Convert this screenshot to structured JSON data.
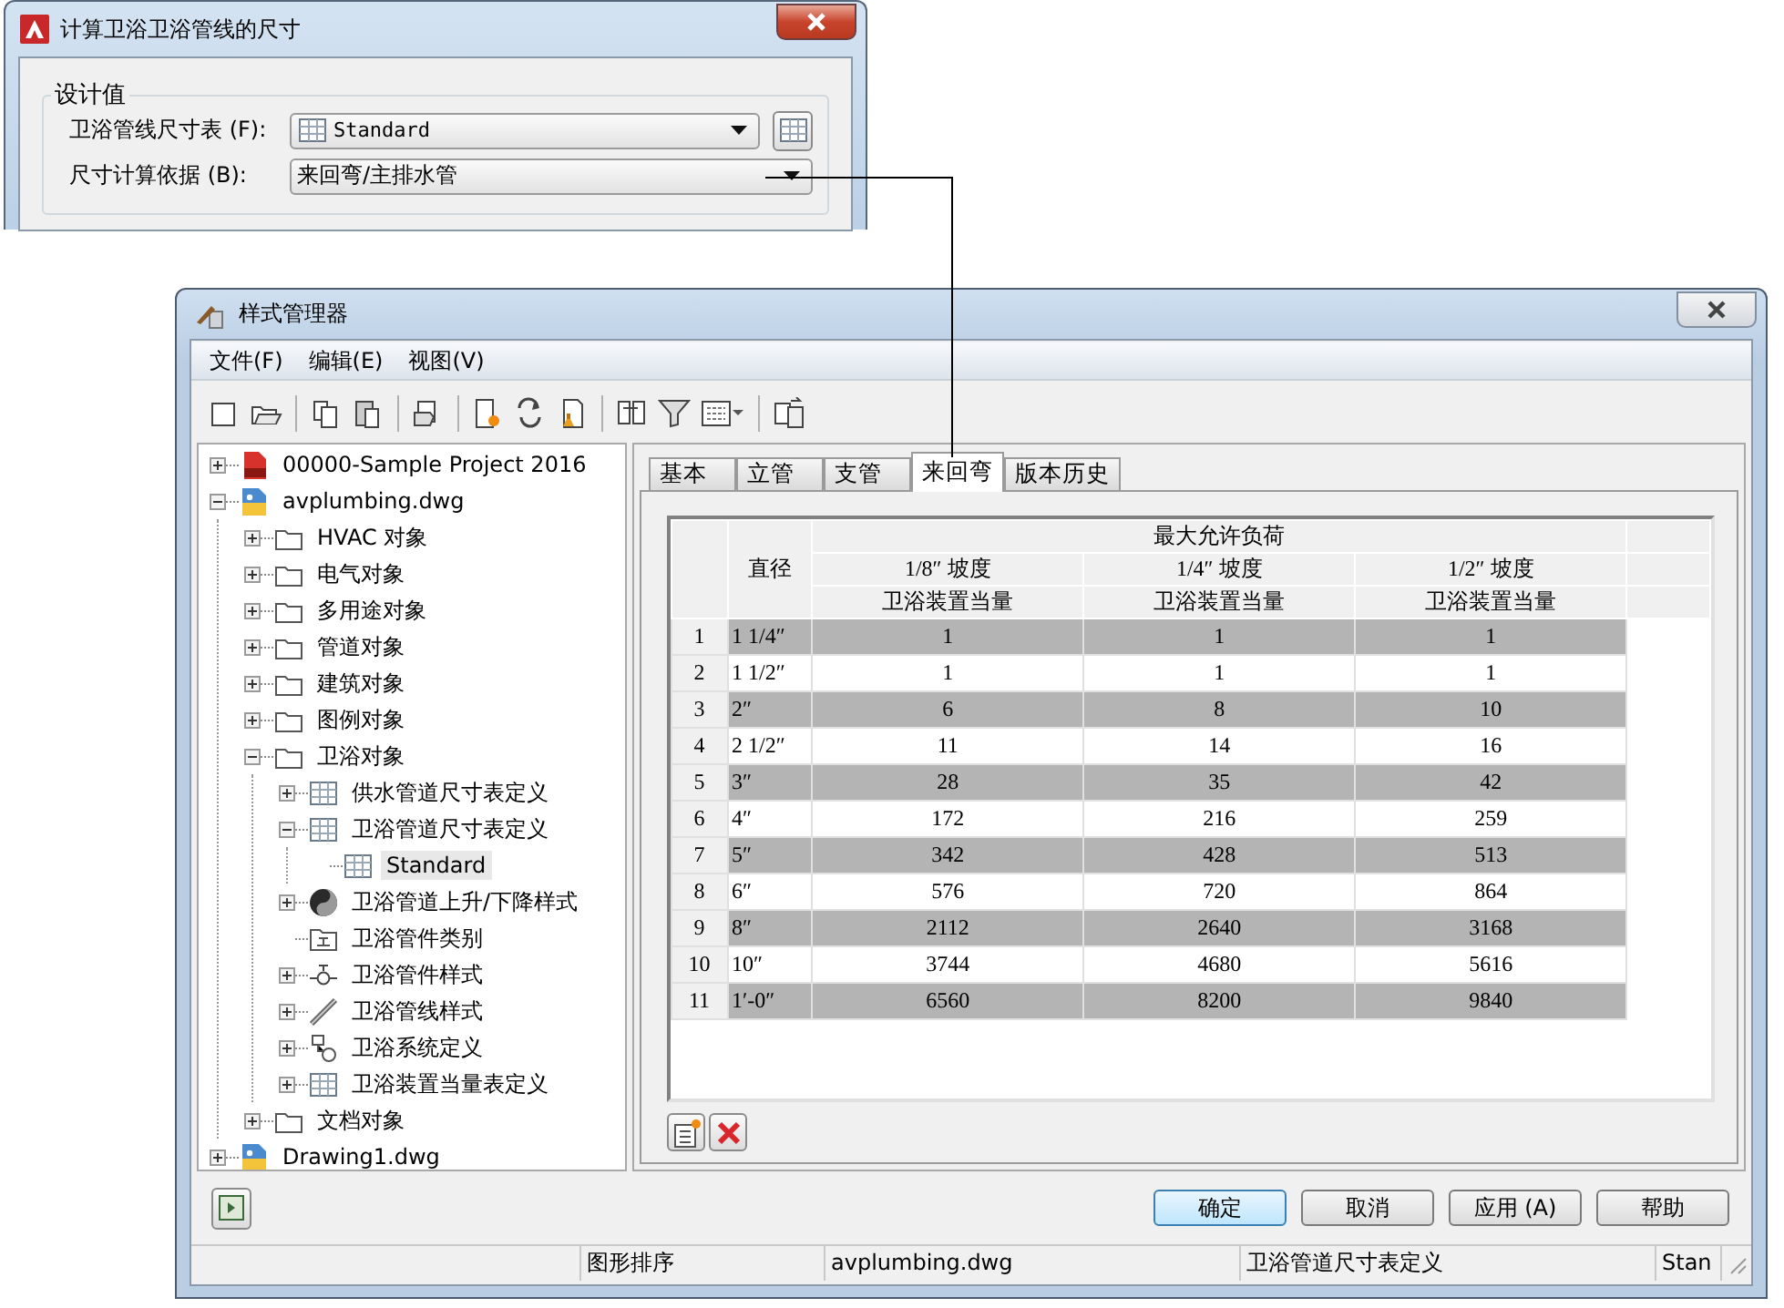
{
  "calc_dialog": {
    "title": "计算卫浴卫浴管线的尺寸",
    "group_label": "设计值",
    "fields": [
      {
        "label": "卫浴管线尺寸表 (F):",
        "value": "Standard",
        "kind": "table"
      },
      {
        "label": "尺寸计算依据 (B):",
        "value": "来回弯/主排水管",
        "kind": "plain"
      }
    ]
  },
  "style_manager": {
    "title": "样式管理器",
    "menu": [
      "文件(F)",
      "编辑(E)",
      "视图(V)"
    ],
    "tree": [
      {
        "label": "00000-Sample Project 2016",
        "kind": "project",
        "expanded": false,
        "selected": false
      },
      {
        "label": "avplumbing.dwg",
        "kind": "drawing",
        "expanded": true,
        "selected": false,
        "children": [
          {
            "label": "HVAC 对象",
            "kind": "folder",
            "expanded": false,
            "selected": false
          },
          {
            "label": "电气对象",
            "kind": "folder",
            "expanded": false,
            "selected": false
          },
          {
            "label": "多用途对象",
            "kind": "folder",
            "expanded": false,
            "selected": false
          },
          {
            "label": "管道对象",
            "kind": "folder",
            "expanded": false,
            "selected": false
          },
          {
            "label": "建筑对象",
            "kind": "folder",
            "expanded": false,
            "selected": false
          },
          {
            "label": "图例对象",
            "kind": "folder",
            "expanded": false,
            "selected": false
          },
          {
            "label": "卫浴对象",
            "kind": "folder",
            "expanded": true,
            "selected": false,
            "children": [
              {
                "label": "供水管道尺寸表定义",
                "kind": "table",
                "expanded": false,
                "selected": false
              },
              {
                "label": "卫浴管道尺寸表定义",
                "kind": "table",
                "expanded": true,
                "selected": false,
                "children": [
                  {
                    "label": "Standard",
                    "kind": "table",
                    "leaf": true,
                    "selected": true
                  }
                ]
              },
              {
                "label": "卫浴管道上升/下降样式",
                "kind": "riser",
                "expanded": false,
                "selected": false
              },
              {
                "label": "卫浴管件类别",
                "kind": "category",
                "leaf": true,
                "selected": false
              },
              {
                "label": "卫浴管件样式",
                "kind": "fitting",
                "expanded": false,
                "selected": false
              },
              {
                "label": "卫浴管线样式",
                "kind": "line",
                "expanded": false,
                "selected": false
              },
              {
                "label": "卫浴系统定义",
                "kind": "system",
                "expanded": false,
                "selected": false
              },
              {
                "label": "卫浴装置当量表定义",
                "kind": "table",
                "expanded": false,
                "selected": false
              }
            ]
          },
          {
            "label": "文档对象",
            "kind": "folder",
            "expanded": false,
            "selected": false
          }
        ]
      },
      {
        "label": "Drawing1.dwg",
        "kind": "drawing",
        "expanded": false,
        "selected": false
      }
    ],
    "tabs": [
      {
        "label": "基本",
        "selected": false
      },
      {
        "label": "立管",
        "selected": false
      },
      {
        "label": "支管",
        "selected": false
      },
      {
        "label": "来回弯",
        "selected": true
      },
      {
        "label": "版本历史",
        "selected": false
      }
    ],
    "table": {
      "diameter_header": "直径",
      "group_header": "最大允许负荷",
      "columns": [
        {
          "slope": "1/8″ 坡度",
          "unit": "卫浴装置当量"
        },
        {
          "slope": "1/4″ 坡度",
          "unit": "卫浴装置当量"
        },
        {
          "slope": "1/2″ 坡度",
          "unit": "卫浴装置当量"
        }
      ],
      "rows": [
        {
          "number": "1",
          "diameter": "1 1/4″",
          "values": [
            "1",
            "1",
            "1"
          ]
        },
        {
          "number": "2",
          "diameter": "1 1/2″",
          "values": [
            "1",
            "1",
            "1"
          ]
        },
        {
          "number": "3",
          "diameter": "2″",
          "values": [
            "6",
            "8",
            "10"
          ]
        },
        {
          "number": "4",
          "diameter": "2 1/2″",
          "values": [
            "11",
            "14",
            "16"
          ]
        },
        {
          "number": "5",
          "diameter": "3″",
          "values": [
            "28",
            "35",
            "42"
          ]
        },
        {
          "number": "6",
          "diameter": "4″",
          "values": [
            "172",
            "216",
            "259"
          ]
        },
        {
          "number": "7",
          "diameter": "5″",
          "values": [
            "342",
            "428",
            "513"
          ]
        },
        {
          "number": "8",
          "diameter": "6″",
          "values": [
            "576",
            "720",
            "864"
          ]
        },
        {
          "number": "9",
          "diameter": "8″",
          "values": [
            "2112",
            "2640",
            "3168"
          ]
        },
        {
          "number": "10",
          "diameter": "10″",
          "values": [
            "3744",
            "4680",
            "5616"
          ]
        },
        {
          "number": "11",
          "diameter": "1′-0″",
          "values": [
            "6560",
            "8200",
            "9840"
          ]
        }
      ]
    },
    "buttons": [
      {
        "label": "确定",
        "default": true
      },
      {
        "label": "取消",
        "default": false
      },
      {
        "label": "应用 (A)",
        "default": false
      },
      {
        "label": "帮助",
        "default": false
      }
    ],
    "status_bar": [
      "图形排序",
      "avplumbing.dwg",
      "卫浴管道尺寸表定义",
      "Stan"
    ]
  }
}
